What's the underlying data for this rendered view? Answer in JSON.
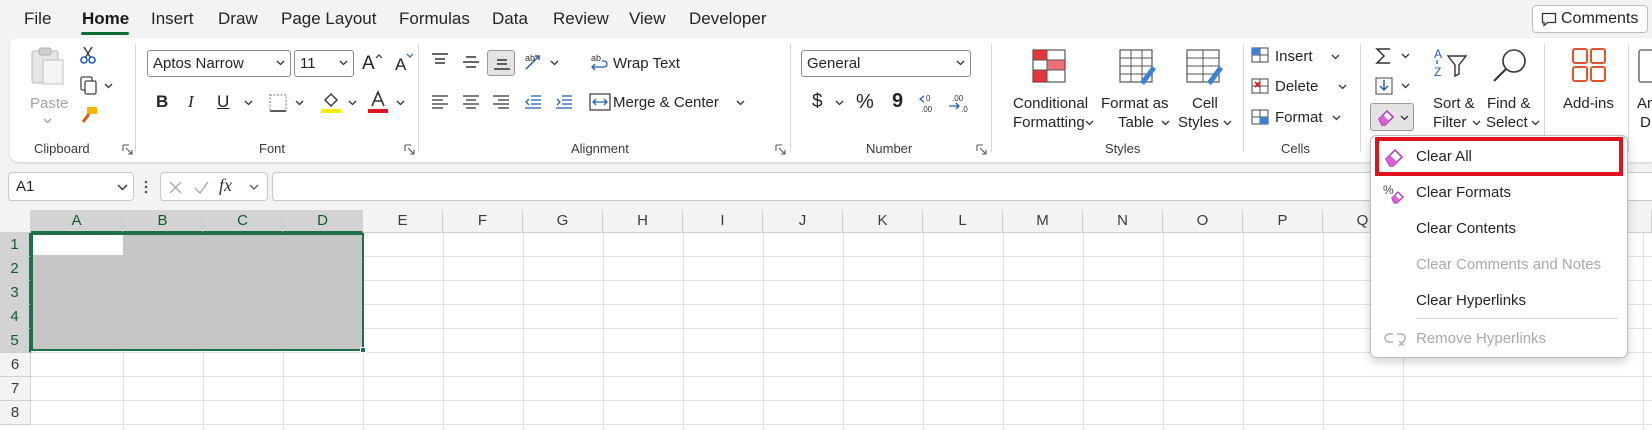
{
  "menu": {
    "tabs": [
      "File",
      "Home",
      "Insert",
      "Draw",
      "Page Layout",
      "Formulas",
      "Data",
      "Review",
      "View",
      "Developer"
    ],
    "active": "Home",
    "comments_label": "Comments"
  },
  "clipboard": {
    "paste_label": "Paste",
    "group_label": "Clipboard"
  },
  "font": {
    "font_name": "Aptos Narrow",
    "font_size": "11",
    "group_label": "Font",
    "bold": "B",
    "italic": "I",
    "underline": "U",
    "grow": "A",
    "shrink": "A",
    "highlight_color": "#ffeb00",
    "font_color": "#e0121d"
  },
  "alignment": {
    "wrap_text": "Wrap Text",
    "merge_center": "Merge & Center",
    "group_label": "Alignment"
  },
  "number": {
    "format": "General",
    "currency": "$",
    "percent": "%",
    "comma": "9",
    "group_label": "Number"
  },
  "styles": {
    "conditional_1": "Conditional",
    "conditional_2": "Formatting",
    "format_table_1": "Format as",
    "format_table_2": "Table",
    "cell_styles_1": "Cell",
    "cell_styles_2": "Styles",
    "group_label": "Styles"
  },
  "cells": {
    "insert": "Insert",
    "delete": "Delete",
    "format": "Format",
    "group_label": "Cells"
  },
  "editing": {
    "sort_1": "Sort &",
    "sort_2": "Filter",
    "find_1": "Find &",
    "find_2": "Select"
  },
  "addins": {
    "label": "Add-ins",
    "cut_label_1": "An",
    "cut_label_2": "D"
  },
  "formula_bar": {
    "name_box": "A1",
    "fx": "fx",
    "formula": ""
  },
  "grid": {
    "columns": [
      "A",
      "B",
      "C",
      "D",
      "E",
      "F",
      "G",
      "H",
      "I",
      "J",
      "K",
      "L",
      "M",
      "N",
      "O",
      "P",
      "Q"
    ],
    "rows": [
      "1",
      "2",
      "3",
      "4",
      "5",
      "6",
      "7",
      "8"
    ],
    "selected_columns": [
      "A",
      "B",
      "C",
      "D"
    ],
    "selected_rows": [
      "1",
      "2",
      "3",
      "4",
      "5"
    ]
  },
  "clear_menu": {
    "items": [
      {
        "label": "Clear All",
        "enabled": true,
        "highlighted": true
      },
      {
        "label": "Clear Formats",
        "enabled": true
      },
      {
        "label": "Clear Contents",
        "enabled": true
      },
      {
        "label": "Clear Comments and Notes",
        "enabled": false
      },
      {
        "label": "Clear Hyperlinks",
        "enabled": true
      },
      {
        "label": "Remove Hyperlinks",
        "enabled": false
      }
    ]
  },
  "colors": {
    "accent_green": "#1e7145",
    "highlight_red": "#e0121d",
    "eraser_purple": "#b52fb5"
  }
}
